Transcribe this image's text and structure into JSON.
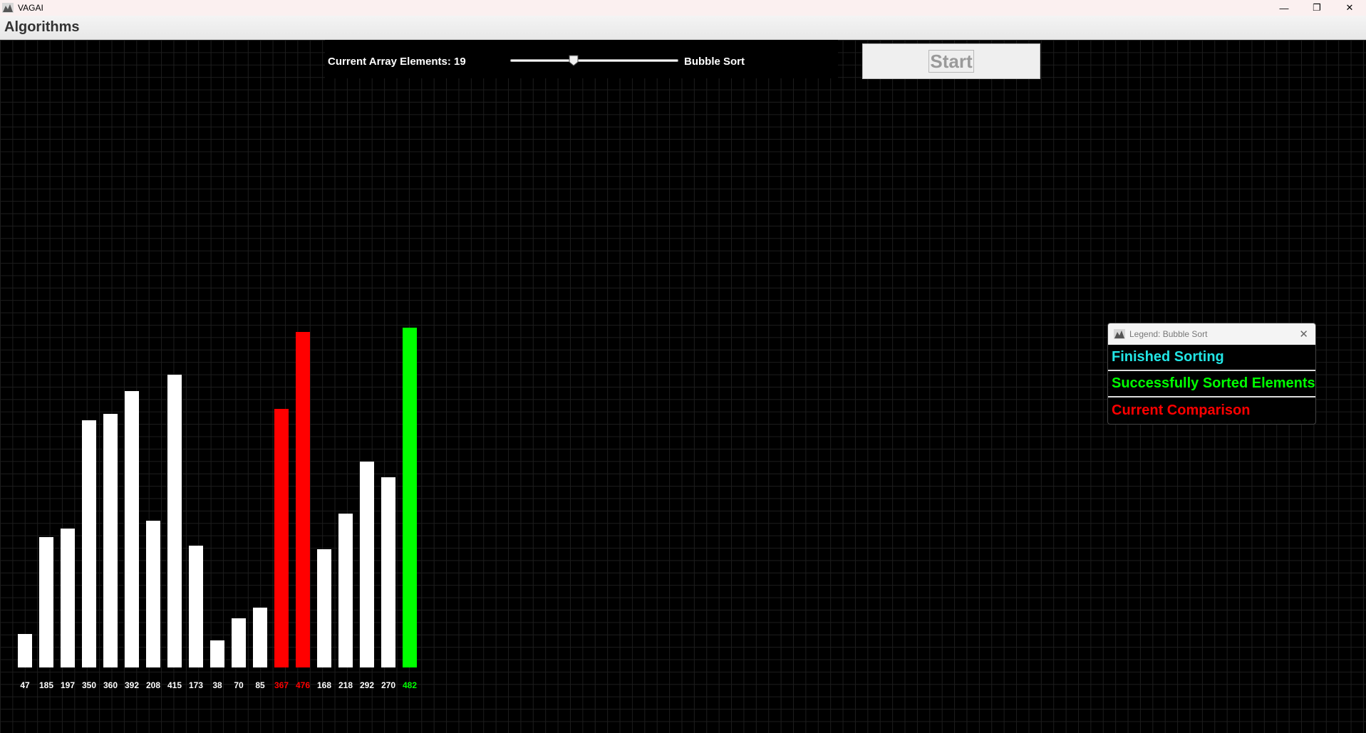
{
  "window": {
    "title": "VAGAI",
    "minimize": "—",
    "restore": "❐",
    "close": "✕"
  },
  "menu": {
    "title": "Algorithms"
  },
  "controls": {
    "array_label": "Current Array Elements: 19",
    "slider_value": 19,
    "algorithm": "Bubble Sort",
    "start_label": "Start"
  },
  "chart_data": {
    "type": "bar",
    "categories": [
      "47",
      "185",
      "197",
      "350",
      "360",
      "392",
      "208",
      "415",
      "173",
      "38",
      "70",
      "85",
      "367",
      "476",
      "168",
      "218",
      "292",
      "270",
      "482"
    ],
    "values": [
      47,
      185,
      197,
      350,
      360,
      392,
      208,
      415,
      173,
      38,
      70,
      85,
      367,
      476,
      168,
      218,
      292,
      270,
      482
    ],
    "states": [
      "default",
      "default",
      "default",
      "default",
      "default",
      "default",
      "default",
      "default",
      "default",
      "default",
      "default",
      "default",
      "comparison",
      "comparison",
      "default",
      "default",
      "default",
      "default",
      "sorted"
    ],
    "colors": {
      "default": "#ffffff",
      "comparison": "#ff0000",
      "sorted": "#00ff00",
      "finished": "#22e5e5"
    },
    "grid": true
  },
  "legend": {
    "title": "Legend: Bubble Sort",
    "close": "✕",
    "items": [
      {
        "label": "Finished Sorting",
        "color": "#22e5e5"
      },
      {
        "label": "Successfully Sorted Elements",
        "color": "#00ff00"
      },
      {
        "label": "Current Comparison",
        "color": "#ff0000"
      }
    ]
  }
}
